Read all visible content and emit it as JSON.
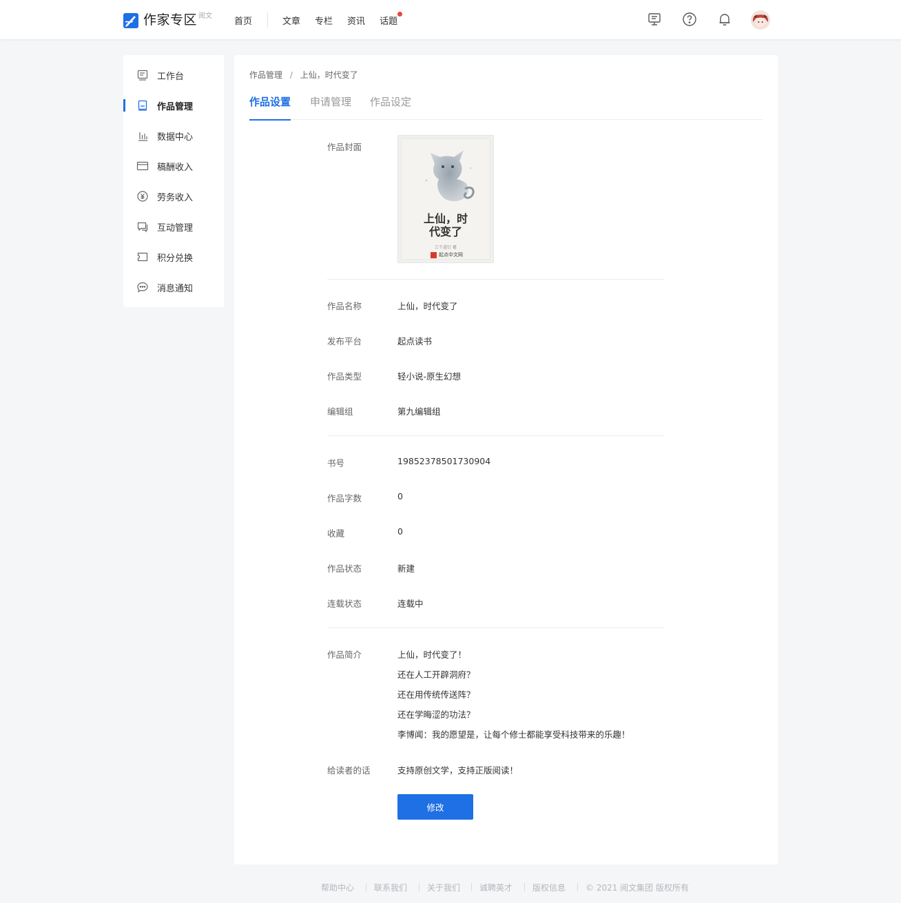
{
  "header": {
    "logo_title": "作家专区",
    "logo_sub": "阅文",
    "nav": [
      "首页",
      "文章",
      "专栏",
      "资讯",
      "话题"
    ],
    "icons": [
      "feedback-icon",
      "help-icon",
      "bell-icon",
      "avatar"
    ]
  },
  "sidebar": {
    "items": [
      {
        "label": "工作台",
        "icon": "workbench-icon"
      },
      {
        "label": "作品管理",
        "icon": "book-icon",
        "active": true
      },
      {
        "label": "数据中心",
        "icon": "bar-chart-icon"
      },
      {
        "label": "稿酬收入",
        "icon": "card-icon"
      },
      {
        "label": "劳务收入",
        "icon": "yuan-coin-icon"
      },
      {
        "label": "互动管理",
        "icon": "chat-icon"
      },
      {
        "label": "积分兑换",
        "icon": "ticket-icon"
      },
      {
        "label": "消息通知",
        "icon": "message-icon"
      }
    ]
  },
  "breadcrumb": [
    "作品管理",
    "上仙，时代变了"
  ],
  "tabs": [
    {
      "label": "作品设置",
      "active": true
    },
    {
      "label": "申请管理"
    },
    {
      "label": "作品设定"
    }
  ],
  "cover": {
    "label": "作品封面",
    "title_line1": "上仙，时",
    "title_line2": "代变了",
    "author": "三千道钉 著",
    "brand": "起点中文网"
  },
  "info": {
    "name_label": "作品名称",
    "name": "上仙，时代变了",
    "platform_label": "发布平台",
    "platform": "起点读书",
    "category_label": "作品类型",
    "category": "轻小说-原生幻想",
    "group_label": "编辑组",
    "group": "第九编辑组",
    "book_id_label": "书号",
    "book_id": "19852378501730904",
    "word_count_label": "作品字数",
    "word_count": "0",
    "favorites_label": "收藏",
    "favorites": "0",
    "status_label": "作品状态",
    "status": "新建",
    "serial_label": "连载状态",
    "serial": "连载中"
  },
  "intro": {
    "label": "作品简介",
    "lines": [
      "上仙，时代变了！",
      "还在人工开辟洞府？",
      "还在用传统传送阵？",
      "还在学晦涩的功法？",
      "李博闻：我的愿望是，让每个修士都能享受科技带来的乐趣！"
    ]
  },
  "reader_note": {
    "label": "给读者的话",
    "text": "支持原创文学，支持正版阅读！"
  },
  "edit_button": "修改",
  "footer": [
    "帮助中心",
    "联系我们",
    "关于我们",
    "诚聘英才",
    "版权信息",
    "© 2021 阅文集团 版权所有"
  ],
  "colors": {
    "accent": "#1f6fe5",
    "badge": "#e9453a",
    "page_bg": "#f5f6f8"
  }
}
